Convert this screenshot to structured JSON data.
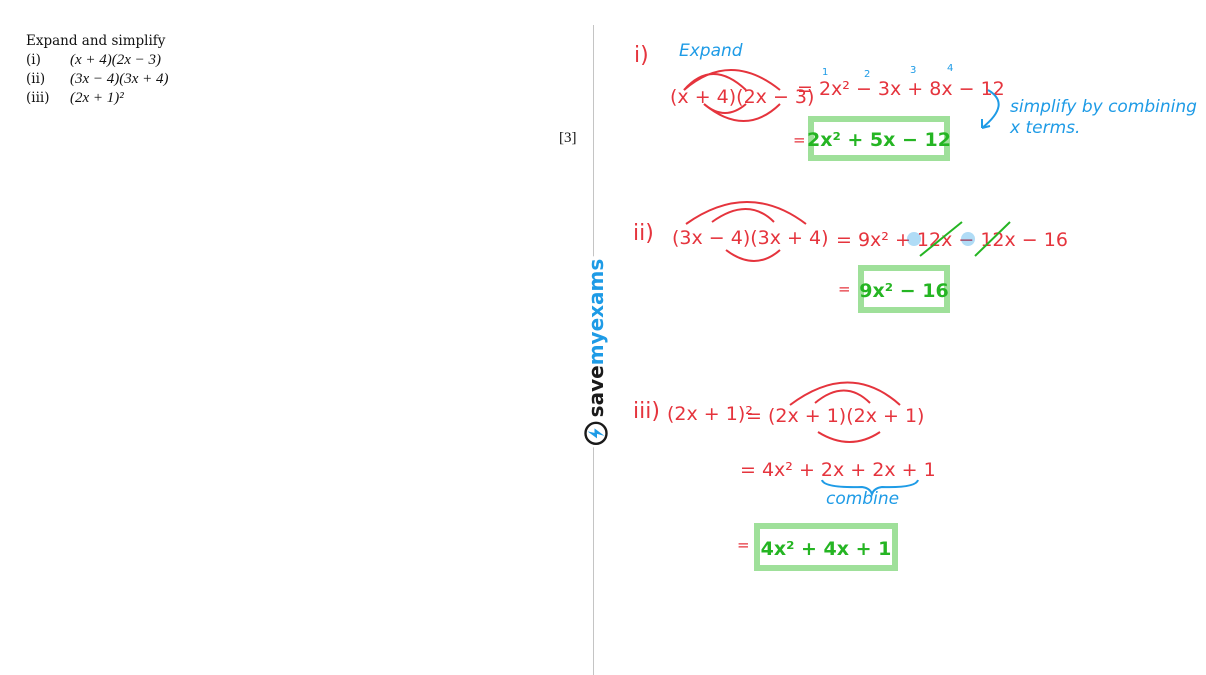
{
  "question": {
    "instruction": "Expand and simplify",
    "parts": [
      {
        "num": "(i)",
        "expr": "(x + 4)(2x − 3)"
      },
      {
        "num": "(ii)",
        "expr": "(3x − 4)(3x + 4)"
      },
      {
        "num": "(iii)",
        "expr": "(2x + 1)²"
      }
    ],
    "marks": "[3]"
  },
  "brand": {
    "word1": "save",
    "word2": "my",
    "word3": "exams"
  },
  "solution": {
    "part1": {
      "label": "i)",
      "note": "Expand",
      "expression": "(x + 4)(2x − 3)",
      "expansion": "= 2x² − 3x + 8x − 12",
      "term_numbers": [
        "1",
        "2",
        "3",
        "4"
      ],
      "comment_line1": "simplify by combining",
      "comment_line2": "x terms.",
      "equals": "=",
      "answer": "2x² + 5x − 12"
    },
    "part2": {
      "label": "ii)",
      "expression": "(3x − 4)(3x + 4)",
      "expansion": "= 9x² + 12x − 12x − 16",
      "equals": "=",
      "answer": "9x² − 16"
    },
    "part3": {
      "label": "iii)",
      "expression": "(2x + 1)²",
      "rewrite": "= (2x + 1)(2x + 1)",
      "expansion": "= 4x² + 2x + 2x + 1",
      "note": "combine",
      "equals": "=",
      "answer": "4x² + 4x + 1"
    }
  },
  "colors": {
    "working": "#e5343d",
    "notes": "#1e9be6",
    "answer": "#25b523",
    "answer_box": "#9fe09a"
  }
}
